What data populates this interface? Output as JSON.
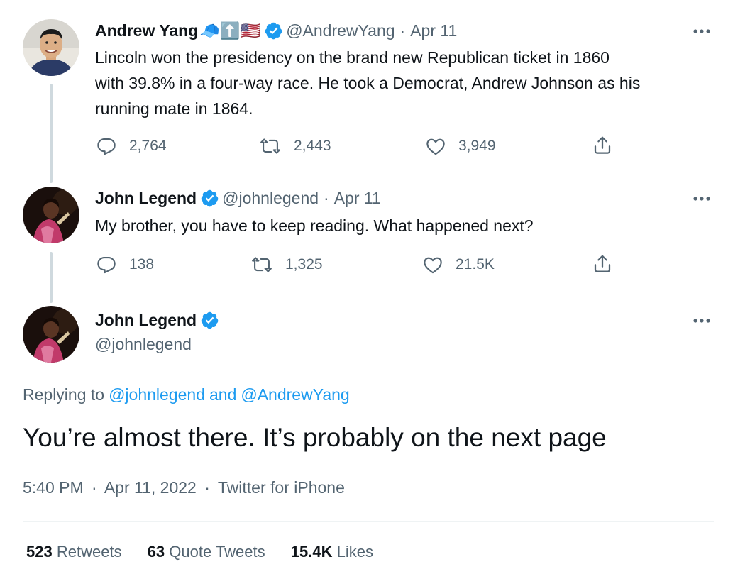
{
  "tweets": [
    {
      "name": "Andrew Yang",
      "emoji": "🧢⬆️🇺🇸",
      "handle": "@AndrewYang",
      "sep": "·",
      "date": "Apr 11",
      "lines": [
        "Lincoln won the presidency on the brand new Republican ticket in 1860",
        "with 39.8% in a four-way race. He took a Democrat, Andrew Johnson as his",
        "running mate in 1864."
      ],
      "replies": "2,764",
      "retweets": "2,443",
      "likes": "3,949"
    },
    {
      "name": "John Legend",
      "handle": "@johnlegend",
      "sep": "·",
      "date": "Apr 11",
      "lines": [
        "My brother, you have to keep reading. What happened next?"
      ],
      "replies": "138",
      "retweets": "1,325",
      "likes": "21.5K"
    }
  ],
  "main": {
    "name": "John Legend",
    "handle": "@johnlegend",
    "replying_prefix": "Replying to",
    "replying_user1": "@johnlegend",
    "replying_and": "and",
    "replying_user2": "@AndrewYang",
    "text": "You’re almost there. It’s probably on the next page",
    "time": "5:40 PM",
    "sep1": "·",
    "date": "Apr 11, 2022",
    "sep2": "·",
    "source": "Twitter for iPhone",
    "retweets_count": "523",
    "retweets_label": "Retweets",
    "quotes_count": "63",
    "quotes_label": "Quote Tweets",
    "likes_count": "15.4K",
    "likes_label": "Likes"
  },
  "colors": {
    "accent": "#1d9bf0",
    "muted": "#536471",
    "text": "#0f1419",
    "thread_line": "#cfd9de"
  },
  "icons": [
    "more-icon",
    "reply-icon",
    "retweet-icon",
    "like-icon",
    "share-icon",
    "verified-icon"
  ]
}
